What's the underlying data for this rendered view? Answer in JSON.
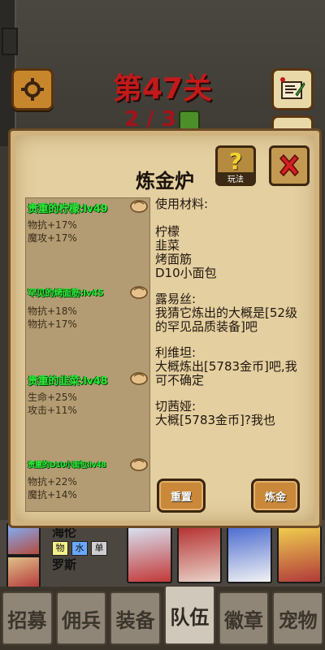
{
  "header": {
    "level_title": "第47关",
    "progress": "2 / 3",
    "settings_icon": "gear-icon",
    "mail_icon": "letter-icon"
  },
  "dialog": {
    "title": "炼金炉",
    "help_label": "玩法",
    "help_glyph": "?",
    "items": [
      {
        "name": "贵重的柠檬:lv49",
        "stats": [
          "物抗+17%",
          "魔攻+17%"
        ]
      },
      {
        "name": "罕见的烤面筋:lv45",
        "stats": [
          "物抗+18%",
          "物抗+17%"
        ]
      },
      {
        "name": "贵重的韭菜:lv48",
        "stats": [
          "生命+25%",
          "攻击+11%"
        ]
      },
      {
        "name": "贵重的D10小面包:lv48",
        "stats": [
          "物抗+22%",
          "魔抗+14%"
        ]
      }
    ],
    "message": {
      "materials_label": "使用材料:",
      "materials": [
        "柠檬",
        "韭菜",
        "烤面筋",
        "D10小面包"
      ],
      "quotes": [
        {
          "speaker": "露易丝:",
          "text": "我猜它炼出的大概是[52级的罕见品质装备]吧"
        },
        {
          "speaker": "利维坦:",
          "text": "大概炼出[5783金币]吧,我可不确定"
        },
        {
          "speaker": "切茜娅:",
          "text": "大概[5783金币]?我也"
        }
      ]
    },
    "reset_label": "重置",
    "alchemy_label": "炼金"
  },
  "team": {
    "heroes": [
      {
        "name": "海伦",
        "tags": [
          "物",
          "水",
          "单"
        ]
      },
      {
        "name": "罗斯",
        "tags": []
      }
    ]
  },
  "tabs": [
    "招募",
    "佣兵",
    "装备",
    "队伍",
    "徽章",
    "宠物"
  ],
  "active_tab": "队伍",
  "colors": {
    "level_title": "#c21a1a",
    "item_name": "#2de837",
    "dialog_bg": "#e4cfa0"
  }
}
